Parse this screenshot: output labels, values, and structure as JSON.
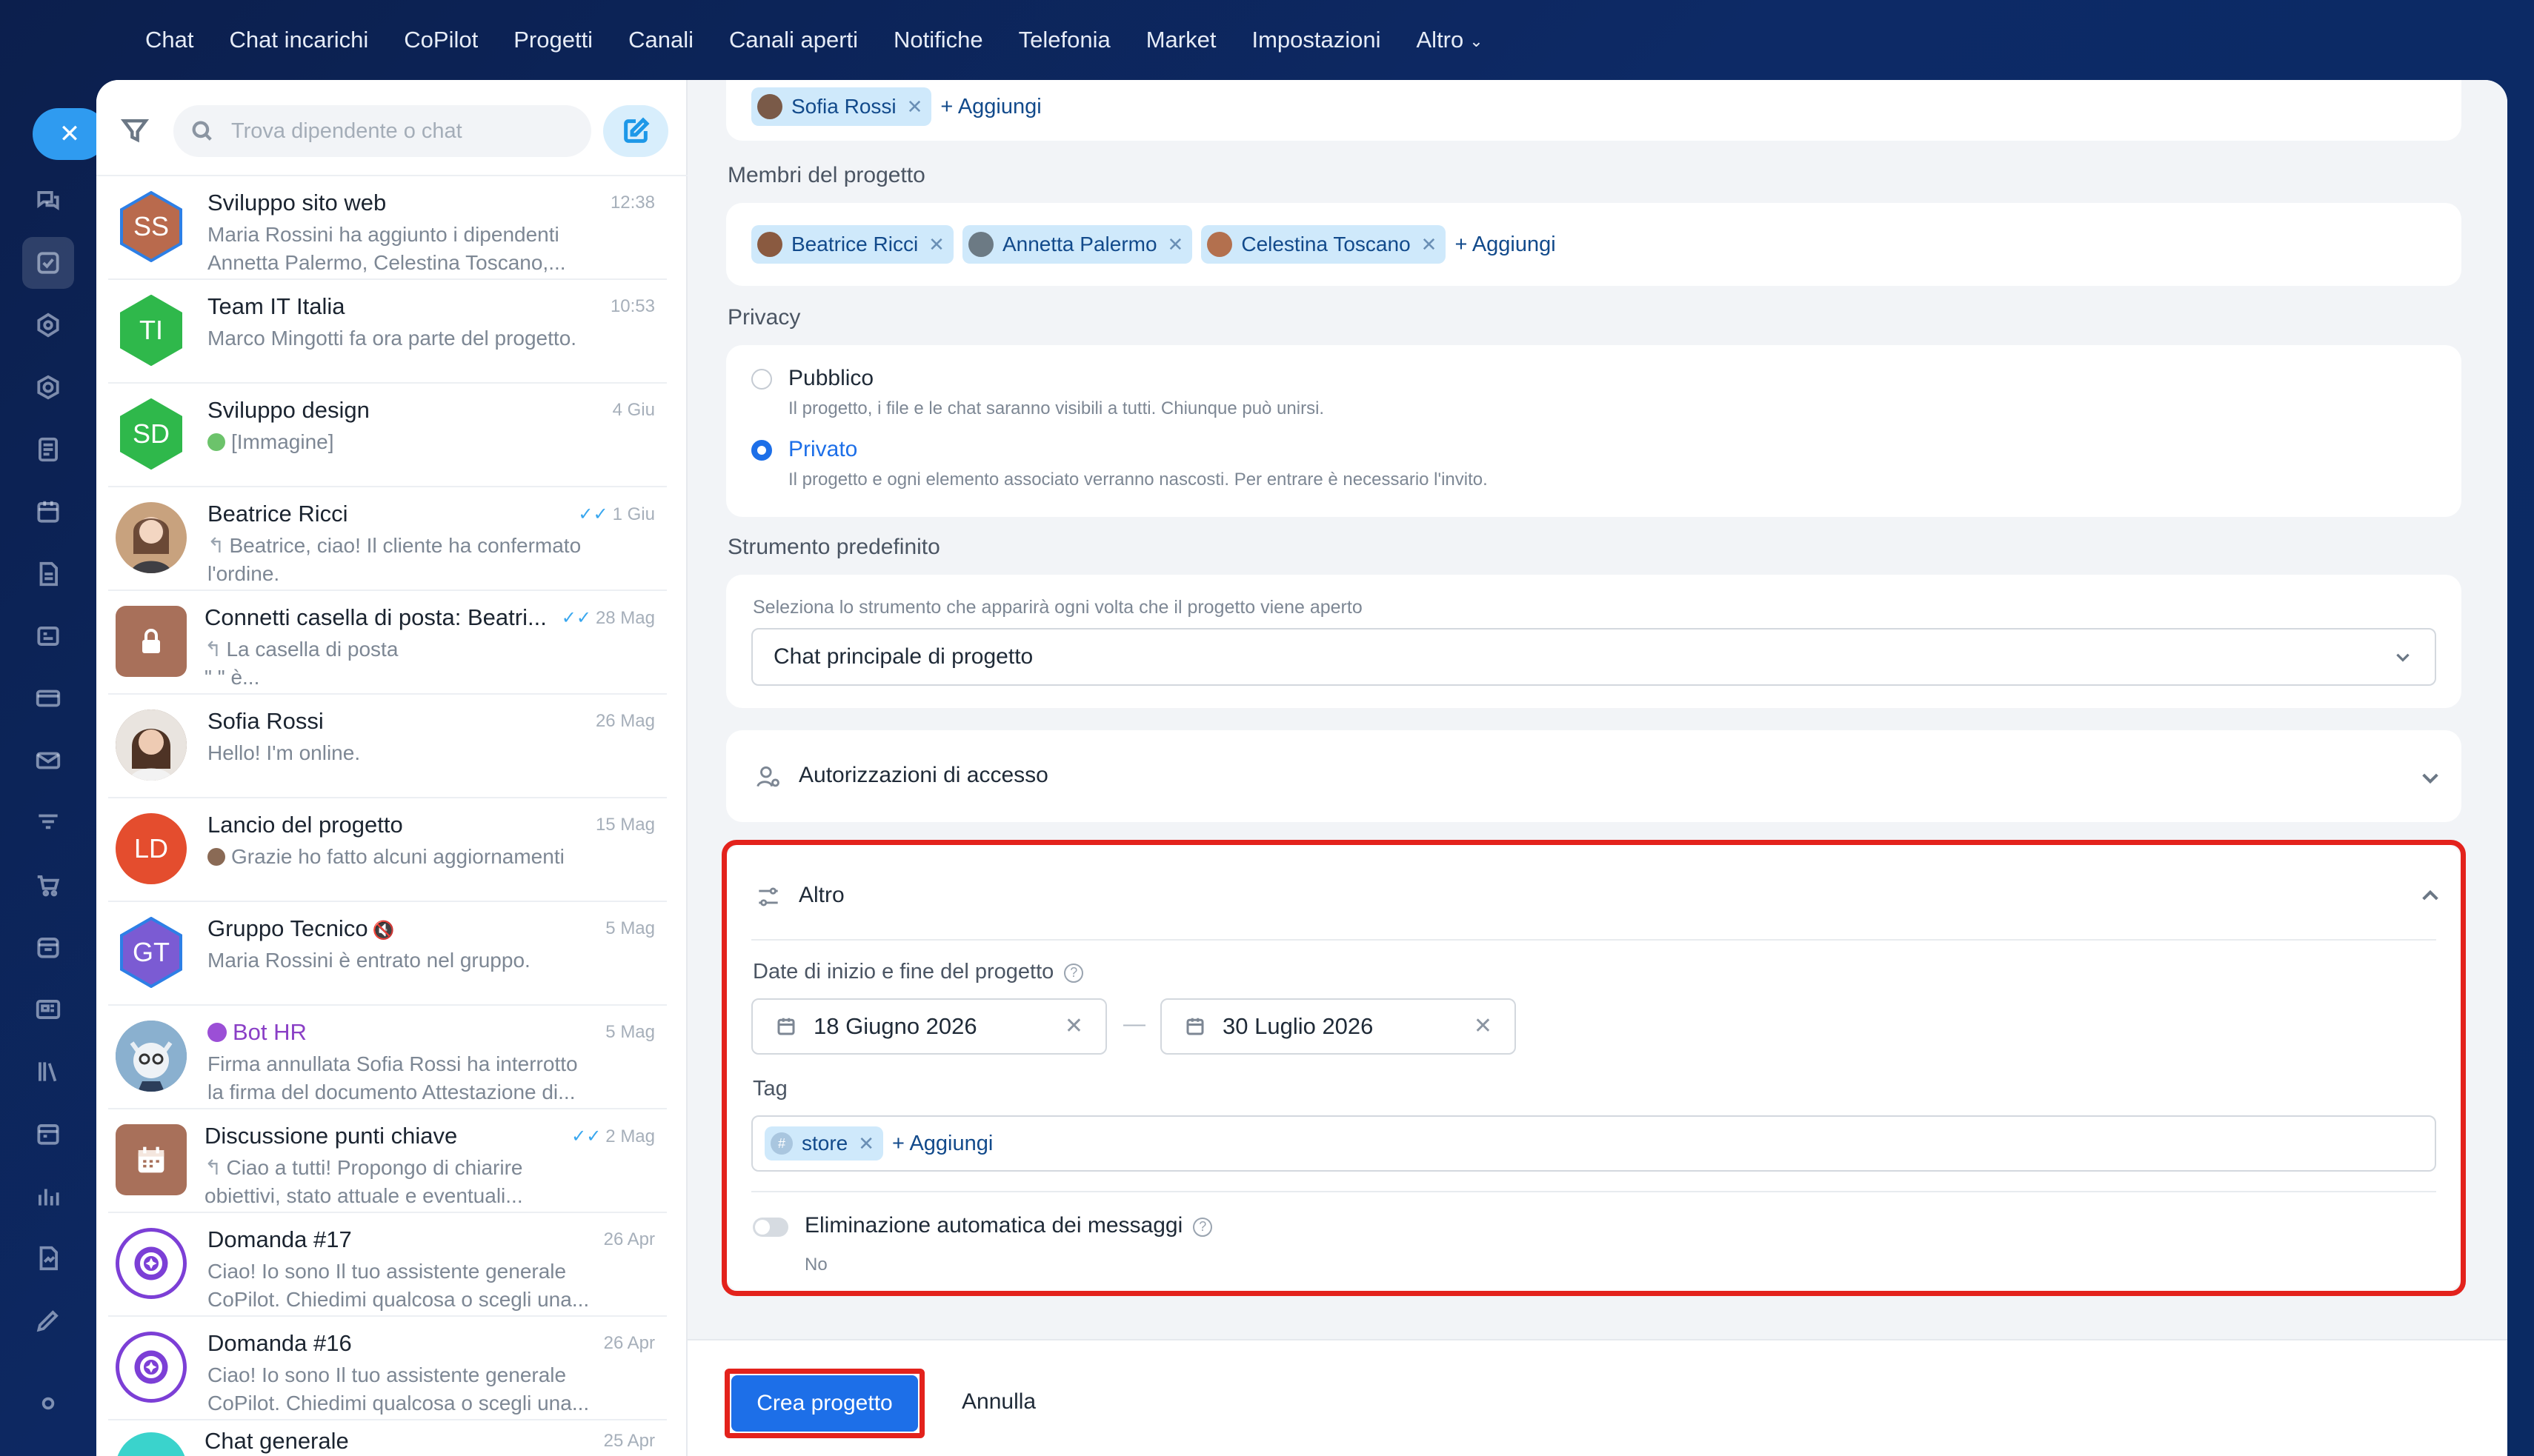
{
  "topnav": {
    "items": [
      "Chat",
      "Chat incarichi",
      "CoPilot",
      "Progetti",
      "Canali",
      "Canali aperti",
      "Notifiche",
      "Telefonia",
      "Market",
      "Impostazioni"
    ],
    "more_label": "Altro"
  },
  "search": {
    "placeholder": "Trova dipendente o chat"
  },
  "chats": [
    {
      "title": "Sviluppo sito web",
      "time": "12:38",
      "line1": "Maria Rossini ha aggiunto i dipendenti",
      "line2": "Annetta Palermo, Celestina Toscano,...",
      "initials": "SS",
      "color": "#b96a4d"
    },
    {
      "title": "Team IT Italia",
      "time": "10:53",
      "line1": "Marco Mingotti fa ora parte del progetto.",
      "line2": "",
      "initials": "TI",
      "color": "#2fb84b"
    },
    {
      "title": "Sviluppo design",
      "time": "4 Giu",
      "line1": "[Immagine]",
      "line2": "",
      "initials": "SD",
      "color": "#2fb84b"
    },
    {
      "title": "Beatrice Ricci",
      "time": "1 Giu",
      "line1": "Beatrice, ciao! Il cliente ha confermato",
      "line2": "l'ordine.",
      "initials": "",
      "color": "#c8a27e"
    },
    {
      "title": "Connetti casella di posta: Beatri...",
      "time": "28 Mag",
      "line1": "La casella di posta",
      "line2": "\"                              \" è...",
      "initials": "",
      "color": "#a8705a"
    },
    {
      "title": "Sofia Rossi",
      "time": "26 Mag",
      "line1": "Hello! I'm online.",
      "line2": "",
      "initials": "",
      "color": "#7a5a48"
    },
    {
      "title": "Lancio del progetto",
      "time": "15 Mag",
      "line1": "Grazie ho fatto alcuni aggiornamenti",
      "line2": "",
      "initials": "LD",
      "color": "#e44d2e"
    },
    {
      "title": "Gruppo Tecnico",
      "time": "5 Mag",
      "line1": "Maria Rossini è entrato nel gruppo.",
      "line2": "",
      "initials": "GT",
      "color": "#7b5bd3"
    },
    {
      "title": "Bot HR",
      "time": "5 Mag",
      "line1": "Firma annullata Sofia Rossi ha interrotto",
      "line2": "la firma del documento Attestazione di...",
      "initials": "",
      "color": "#6c89a8"
    },
    {
      "title": "Discussione punti chiave",
      "time": "2 Mag",
      "line1": "Ciao a tutti! Propongo di chiarire",
      "line2": "obiettivi, stato attuale e eventuali...",
      "initials": "",
      "color": "#a8705a"
    },
    {
      "title": "Domanda #17",
      "time": "26 Apr",
      "line1": "Ciao! Io sono Il tuo assistente generale",
      "line2": "CoPilot. Chiedimi qualcosa o scegli una...",
      "initials": "",
      "color": "#7c3fd6"
    },
    {
      "title": "Domanda #16",
      "time": "26 Apr",
      "line1": "Ciao! Io sono Il tuo assistente generale",
      "line2": "CoPilot. Chiedimi qualcosa o scegli una...",
      "initials": "",
      "color": "#7c3fd6"
    },
    {
      "title": "Chat generale",
      "time": "25 Apr",
      "line1": "",
      "line2": "",
      "initials": "",
      "color": "#3ad3cc"
    }
  ],
  "form": {
    "owner_chip": "Sofia Rossi",
    "add_label": "+ Aggiungi",
    "members_label": "Membri del progetto",
    "members": [
      "Beatrice Ricci",
      "Annetta Palermo",
      "Celestina Toscano"
    ],
    "privacy_label": "Privacy",
    "public_title": "Pubblico",
    "public_desc": "Il progetto, i file e le chat saranno visibili a tutti. Chiunque può unirsi.",
    "private_title": "Privato",
    "private_desc": "Il progetto e ogni elemento associato verranno nascosti. Per entrare è necessario l'invito.",
    "tool_label": "Strumento predefinito",
    "tool_hint": "Seleziona lo strumento che apparirà ogni volta che il progetto viene aperto",
    "tool_value": "Chat principale di progetto",
    "access_label": "Autorizzazioni di accesso",
    "other_label": "Altro",
    "dates_label": "Date di inizio e fine del progetto",
    "start_date": "18 Giugno 2026",
    "end_date": "30 Luglio 2026",
    "dash": "—",
    "tag_label": "Tag",
    "tag_value": "store",
    "auto_delete_label": "Eliminazione automatica dei messaggi",
    "auto_delete_value": "No",
    "create_button": "Crea progetto",
    "cancel_button": "Annulla"
  }
}
